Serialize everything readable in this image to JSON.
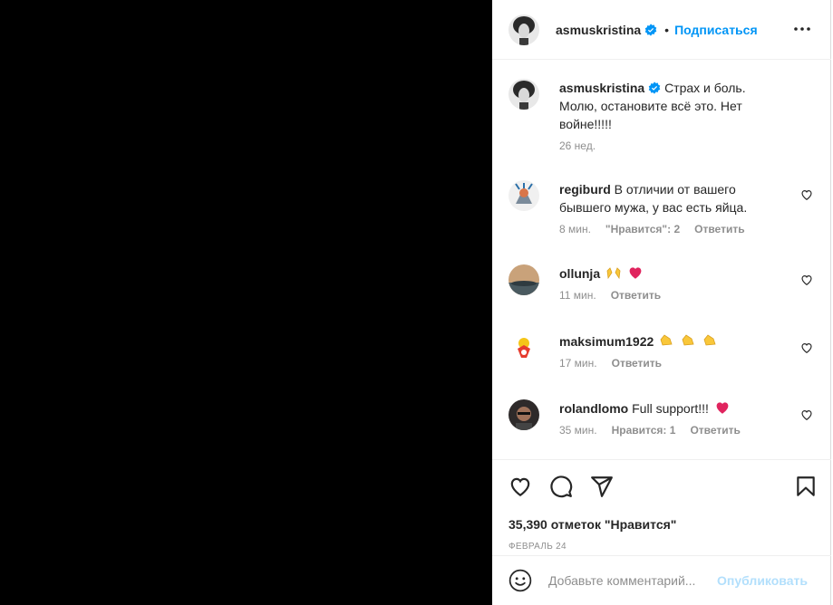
{
  "post": {
    "author": "asmuskristina",
    "follow_label": "Подписаться",
    "separator": "•",
    "caption": "Страх и боль. Молю, остановите всё это. Нет войне!!!!!",
    "caption_time": "26 нед."
  },
  "comments": [
    {
      "user": "regiburd",
      "text": "В отличии от вашего бывшего мужа, у вас есть яйца.",
      "time": "8 мин.",
      "likes": "\"Нравится\": 2",
      "reply": "Ответить"
    },
    {
      "user": "ollunja",
      "text": "",
      "emoji": [
        "raising-hands",
        "red-heart"
      ],
      "time": "11 мин.",
      "reply": "Ответить"
    },
    {
      "user": "maksimum1922",
      "text": "",
      "emoji": [
        "clapping-hands",
        "clapping-hands",
        "clapping-hands"
      ],
      "time": "17 мин.",
      "reply": "Ответить"
    },
    {
      "user": "rolandlomo",
      "text": "Full support!!!",
      "emoji": [
        "red-heart"
      ],
      "time": "35 мин.",
      "likes": "Нравится: 1",
      "reply": "Ответить"
    }
  ],
  "footer": {
    "likes_count": "35,390 отметок \"Нравится\"",
    "date": "ФЕВРАЛЬ 24"
  },
  "composer": {
    "placeholder": "Добавьте комментарий...",
    "publish_label": "Опубликовать"
  },
  "colors": {
    "accent": "#0095f6",
    "accent_disabled": "#b2dffc",
    "muted": "#8e8e8e",
    "heart": "#ed4956"
  }
}
